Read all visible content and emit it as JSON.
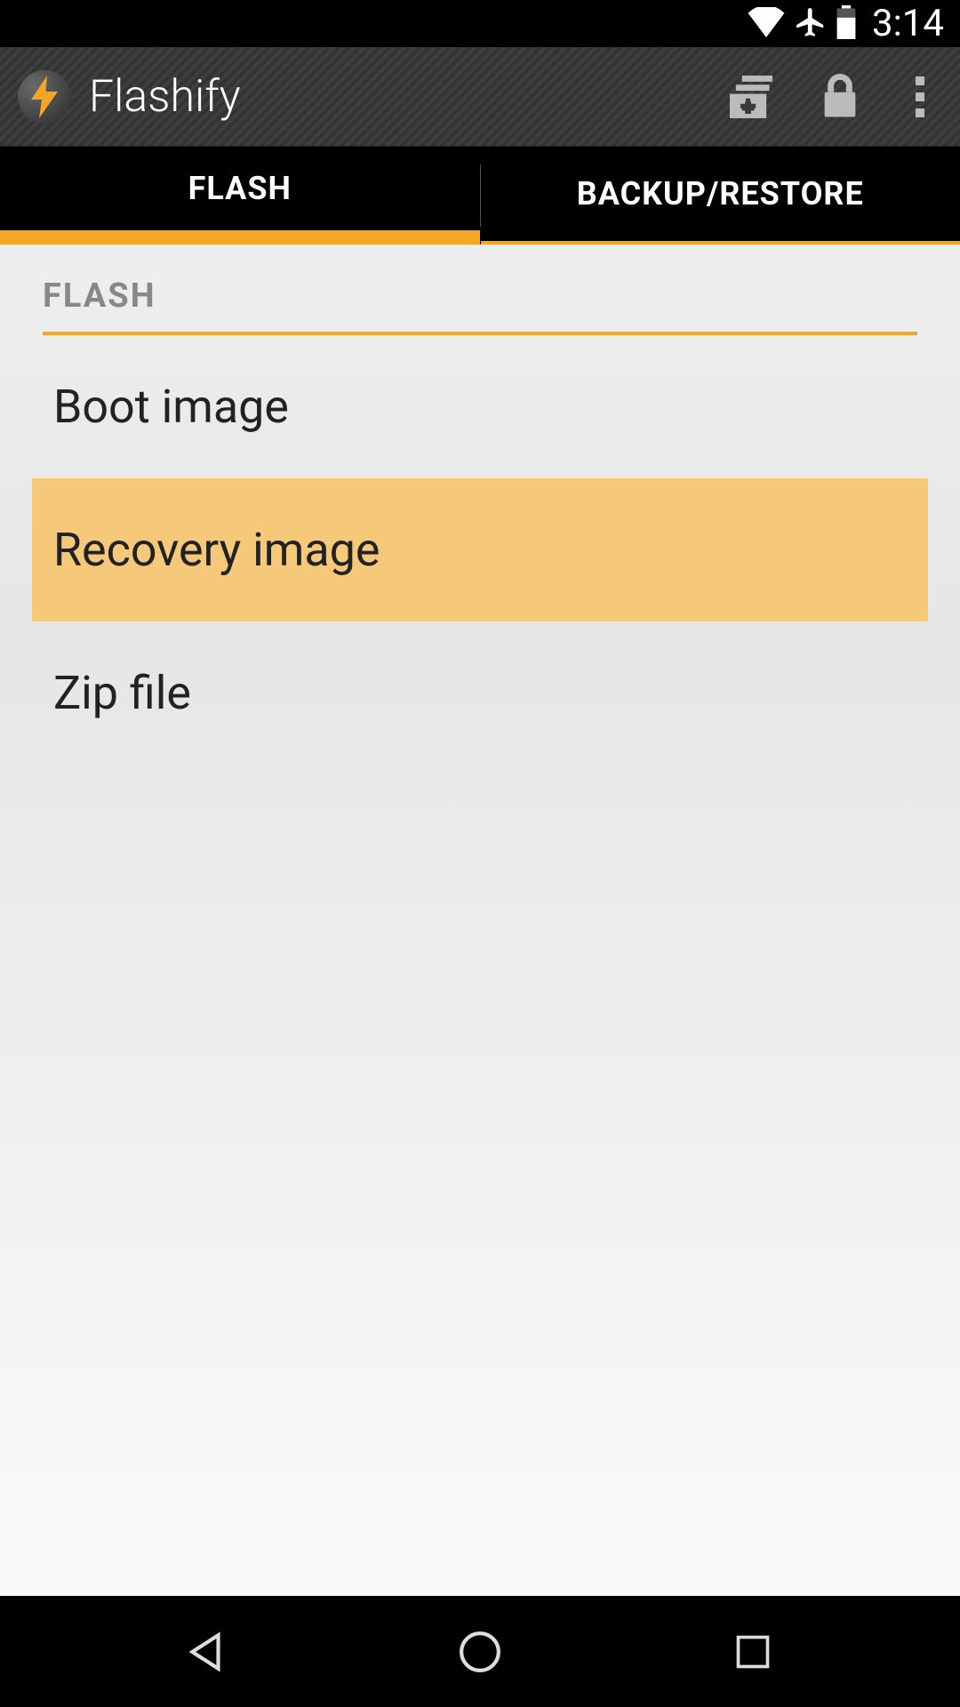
{
  "status": {
    "time": "3:14"
  },
  "appbar": {
    "title": "Flashify"
  },
  "tabs": {
    "flash": "FLASH",
    "backup": "BACKUP/RESTORE"
  },
  "content": {
    "section_header": "FLASH",
    "items": {
      "boot": "Boot image",
      "recovery": "Recovery image",
      "zip": "Zip file"
    }
  }
}
